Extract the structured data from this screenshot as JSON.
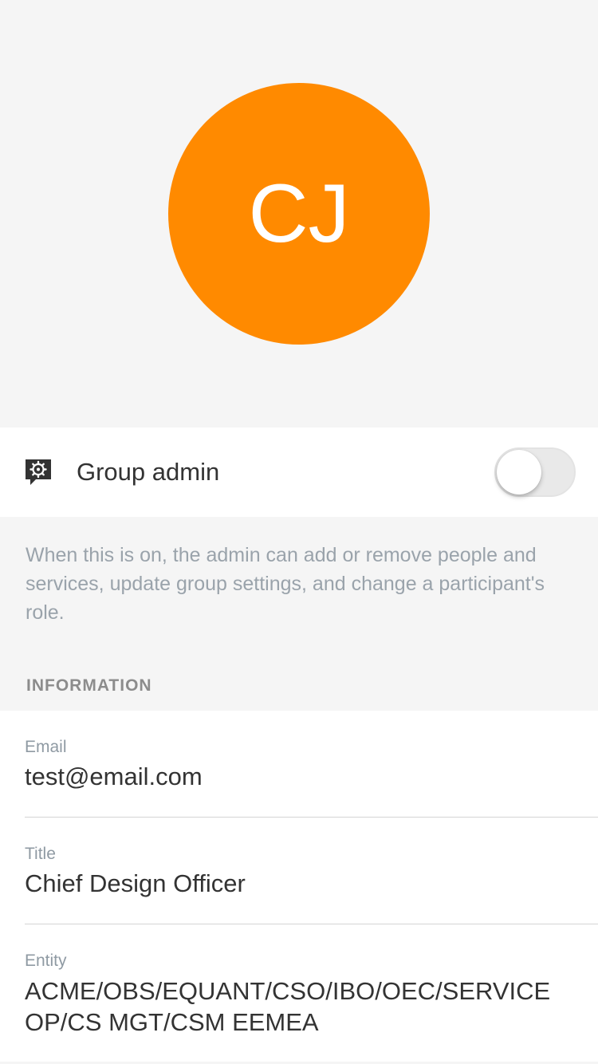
{
  "profile": {
    "initials": "CJ",
    "avatar_color": "#ff8a00"
  },
  "admin": {
    "label": "Group admin",
    "icon": "admin-badge-icon",
    "enabled": false,
    "description": "When this is on, the admin can add or remove people and services, update group settings, and change a participant's role."
  },
  "information": {
    "header": "INFORMATION",
    "fields": [
      {
        "label": "Email",
        "value": "test@email.com"
      },
      {
        "label": "Title",
        "value": "Chief Design Officer"
      },
      {
        "label": "Entity",
        "value_line1": "ACME/OBS/EQUANT/CSO/IBO/OEC/SERVICE",
        "value_line2": "OP/CS MGT/CSM EEMEA"
      }
    ]
  }
}
